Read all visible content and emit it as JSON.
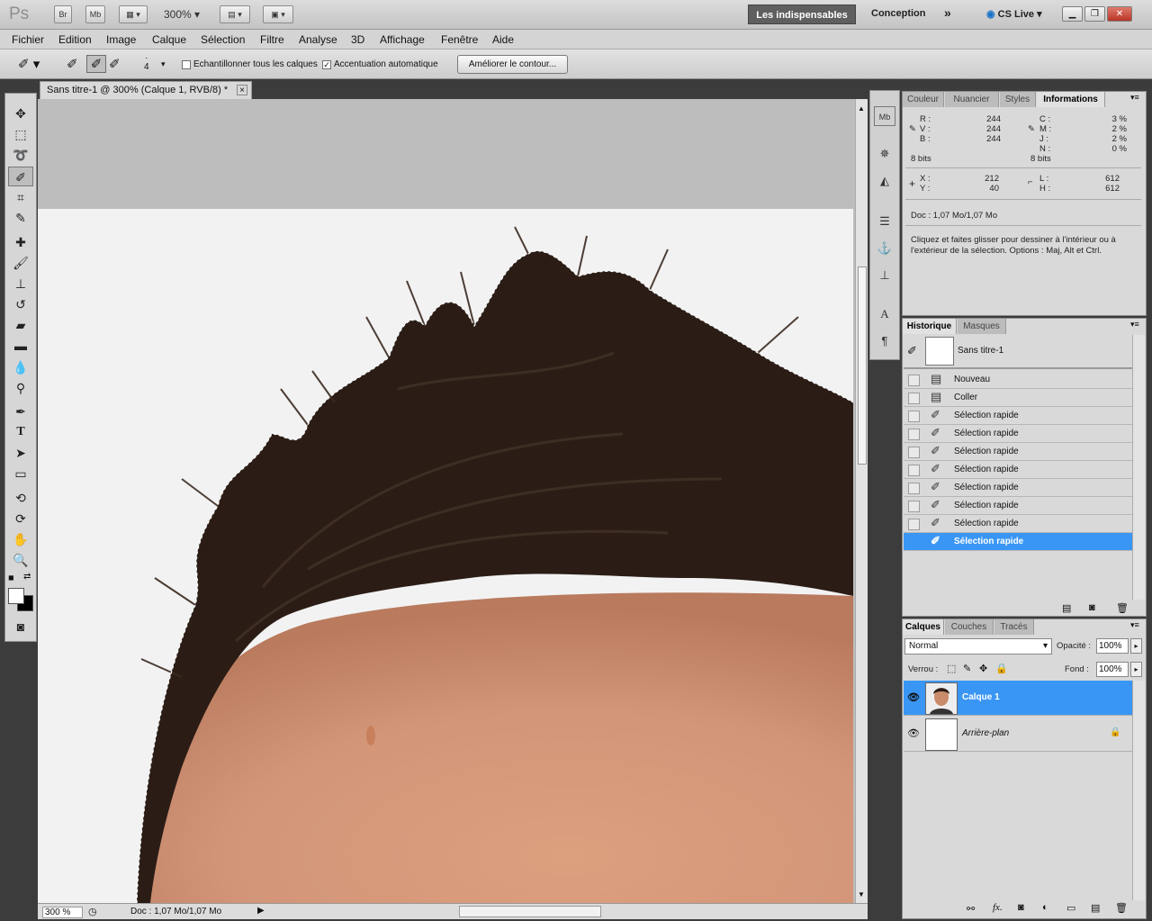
{
  "app": {
    "logo": "Ps",
    "bridge": "Br",
    "minibridge": "Mb",
    "zoom": "300%",
    "workspace_active": "Les indispensables",
    "workspace_other": "Conception",
    "more": "»",
    "cslive": "CS Live"
  },
  "menu": [
    "Fichier",
    "Edition",
    "Image",
    "Calque",
    "Sélection",
    "Filtre",
    "Analyse",
    "3D",
    "Affichage",
    "Fenêtre",
    "Aide"
  ],
  "options": {
    "brush_size": "4",
    "sample_all_label": "Echantillonner tous les calques",
    "auto_enhance_label": "Accentuation automatique",
    "refine_edge_label": "Améliorer le contour...",
    "sample_all_checked": false,
    "auto_enhance_checked": true
  },
  "document": {
    "tab_title": "Sans titre-1 @ 300% (Calque 1, RVB/8) *",
    "close": "×",
    "status_zoom": "300 %",
    "status_doc": "Doc : 1,07 Mo/1,07 Mo"
  },
  "info_panel": {
    "tabs": [
      "Couleur",
      "Nuancier",
      "Styles",
      "Informations"
    ],
    "r_label": "R :",
    "v_label": "V :",
    "b_label": "B :",
    "r": "244",
    "v": "244",
    "b": "244",
    "c_label": "C :",
    "m_label": "M :",
    "j_label": "J :",
    "n_label": "N :",
    "c": "3 %",
    "m": "2 %",
    "j": "2 %",
    "n": "0 %",
    "bits_left": "8 bits",
    "bits_right": "8 bits",
    "x_label": "X :",
    "y_label": "Y :",
    "x": "212",
    "y": "40",
    "l_label": "L :",
    "h_label": "H :",
    "l": "612",
    "h": "612",
    "doc": "Doc : 1,07 Mo/1,07 Mo",
    "hint": "Cliquez et faites glisser pour dessiner à l'intérieur ou à l'extérieur de la sélection. Options : Maj, Alt et Ctrl."
  },
  "history_panel": {
    "tabs": [
      "Historique",
      "Masques"
    ],
    "snapshot": "Sans titre-1",
    "items": [
      "Nouveau",
      "Coller",
      "Sélection rapide",
      "Sélection rapide",
      "Sélection rapide",
      "Sélection rapide",
      "Sélection rapide",
      "Sélection rapide",
      "Sélection rapide",
      "Sélection rapide"
    ]
  },
  "layers_panel": {
    "tabs": [
      "Calques",
      "Couches",
      "Tracés"
    ],
    "blend_mode": "Normal",
    "opacity_label": "Opacité :",
    "opacity": "100%",
    "lock_label": "Verrou :",
    "fill_label": "Fond :",
    "fill": "100%",
    "layers": [
      {
        "name": "Calque 1",
        "selected": true
      },
      {
        "name": "Arrière-plan",
        "selected": false
      }
    ]
  },
  "colors": {
    "accent": "#3a96f4",
    "chrome": "#d6d6d6",
    "hair": "#2b1d16",
    "skin": "#d99d79",
    "bg_canvas": "#f2f2f2",
    "pasteboard": "#bdbdbd"
  }
}
